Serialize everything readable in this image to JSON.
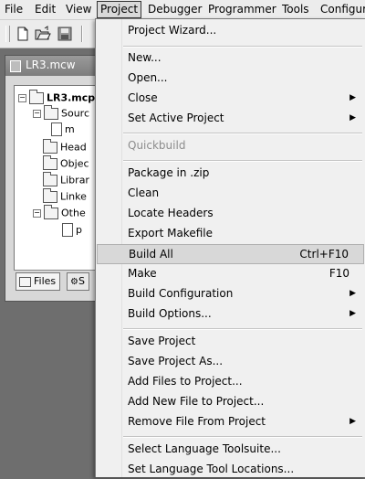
{
  "menubar": {
    "items": [
      {
        "label": "File"
      },
      {
        "label": "Edit"
      },
      {
        "label": "View"
      },
      {
        "label": "Project",
        "active": true
      },
      {
        "label": "Debugger"
      },
      {
        "label": "Programmer"
      },
      {
        "label": "Tools"
      },
      {
        "label": "Configur"
      }
    ]
  },
  "toolbar": {
    "buttons": [
      {
        "icon": "new-file-icon"
      },
      {
        "icon": "open-folder-icon"
      },
      {
        "icon": "save-disk-icon"
      }
    ]
  },
  "workspace": {
    "title": "LR3.mcw",
    "tree": {
      "root": "LR3.mcp",
      "nodes": [
        {
          "label": "Sourc",
          "type": "folder"
        },
        {
          "label": "m",
          "type": "file"
        },
        {
          "label": "Head",
          "type": "folder"
        },
        {
          "label": "Objec",
          "type": "folder"
        },
        {
          "label": "Librar",
          "type": "folder"
        },
        {
          "label": "Linke",
          "type": "folder"
        },
        {
          "label": "Othe",
          "type": "folder"
        },
        {
          "label": "p",
          "type": "file"
        }
      ]
    },
    "tabs": [
      {
        "label": "Files",
        "selected": true
      },
      {
        "label": "S",
        "selected": false
      }
    ]
  },
  "menu": {
    "items": [
      {
        "label": "Project Wizard..."
      },
      {
        "sep": true
      },
      {
        "label": "New..."
      },
      {
        "label": "Open..."
      },
      {
        "label": "Close",
        "submenu": true
      },
      {
        "label": "Set Active Project",
        "submenu": true
      },
      {
        "sep": true
      },
      {
        "label": "Quickbuild",
        "disabled": true
      },
      {
        "sep": true
      },
      {
        "label": "Package in .zip"
      },
      {
        "label": "Clean"
      },
      {
        "label": "Locate Headers"
      },
      {
        "label": "Export Makefile"
      },
      {
        "label": "Build All",
        "shortcut": "Ctrl+F10",
        "highlighted": true
      },
      {
        "label": "Make",
        "shortcut": "F10"
      },
      {
        "label": "Build Configuration",
        "submenu": true
      },
      {
        "label": "Build Options...",
        "submenu": true
      },
      {
        "sep": true
      },
      {
        "label": "Save Project"
      },
      {
        "label": "Save Project As..."
      },
      {
        "label": "Add Files to Project..."
      },
      {
        "label": "Add New File to Project..."
      },
      {
        "label": "Remove File From Project",
        "submenu": true
      },
      {
        "sep": true
      },
      {
        "label": "Select Language Toolsuite..."
      },
      {
        "label": "Set Language Tool Locations..."
      }
    ]
  }
}
